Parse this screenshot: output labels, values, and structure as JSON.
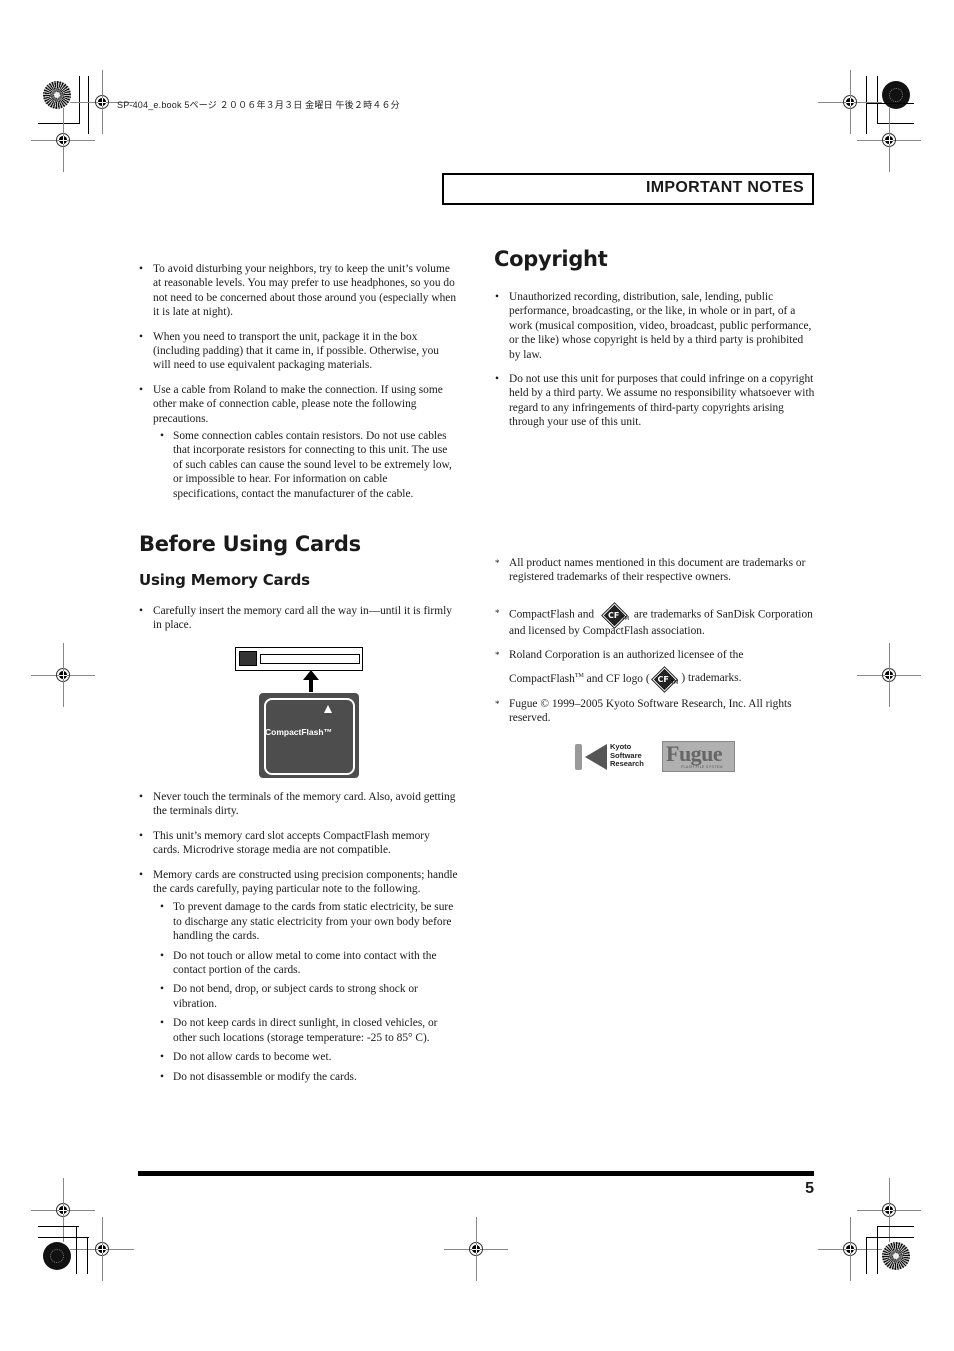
{
  "print_header": "SP-404_e.book  5ページ  ２００６年３月３日  金曜日  午後２時４６分",
  "section_header": "IMPORTANT NOTES",
  "left_column": {
    "intro_bullets": [
      "To avoid disturbing your neighbors, try to keep the unit’s volume at reasonable levels. You may prefer to use headphones, so you do not need to be concerned about those around you (especially when it is late at night).",
      "When you need to transport the unit, package it in the box (including padding) that it came in, if possible. Otherwise, you will need to use equivalent packaging materials.",
      "Use a cable from Roland to make the connection. If using some other make of connection cable, please note the following precautions."
    ],
    "cable_sub_bullets": [
      "Some connection cables contain resistors. Do not use cables that incorporate resistors for connecting to this unit. The use of such cables can cause the sound level to be extremely low, or impossible to hear. For information on cable specifications, contact the manufacturer of the cable."
    ],
    "section_title": "Before Using Cards",
    "subsection_title": "Using Memory Cards",
    "insert_bullet": "Carefully insert the memory card all the way in—until it is firmly in place.",
    "illustration": {
      "card_label": "CompactFlash™"
    },
    "card_bullets": [
      "Never touch the terminals of the memory card. Also, avoid getting the terminals dirty.",
      "This unit’s memory card slot accepts CompactFlash memory cards. Microdrive storage media are not compatible.",
      "Memory cards are constructed using precision components; handle the cards carefully, paying particular note to the following."
    ],
    "card_sub_bullets": [
      "To prevent damage to the cards from static electricity, be sure to discharge any static electricity from your own body before handling the cards.",
      "Do not touch or allow metal to come into contact with the contact portion of the cards.",
      "Do not bend, drop, or subject cards to strong shock or vibration.",
      "Do not keep cards in direct sunlight, in closed vehicles, or other such locations (storage temperature: -25 to 85° C).",
      "Do not allow cards to become wet.",
      "Do not disassemble or modify the cards."
    ]
  },
  "right_column": {
    "section_title": "Copyright",
    "bullets": [
      "Unauthorized recording, distribution, sale, lending, public performance, broadcasting, or the like, in whole or in part, of a work (musical composition, video, broadcast, public performance, or the like) whose copyright is held by a third party is prohibited by law.",
      "Do not use this unit for purposes that could infringe on a copyright held by a third party. We assume no responsibility whatsoever with regard to any infringements of third-party copyrights arising through your use of this unit."
    ],
    "notes": {
      "marker": "*",
      "trademarks": "All product names mentioned in this document are trademarks or registered trademarks of their respective owners.",
      "cf_pre": "CompactFlash and",
      "cf_post": "are trademarks of SanDisk Corporation and licensed by CompactFlash association.",
      "roland_line1": "Roland Corporation is an authorized licensee of the",
      "roland_pre": "CompactFlash",
      "roland_tm": "TM",
      "roland_mid": "and CF logo (",
      "roland_post": ") trademarks.",
      "fugue": "Fugue © 1999–2005 Kyoto Software Research, Inc. All rights reserved."
    },
    "cf_logo": {
      "text": "CF",
      "tm": "TM"
    },
    "logos": {
      "ksr_lines": [
        "Kyoto",
        "Software",
        "Research"
      ],
      "fugue_word": "Fugue",
      "fugue_tag": "FLASH FILE SYSTEM"
    }
  },
  "footer": {
    "page_number": "5"
  }
}
